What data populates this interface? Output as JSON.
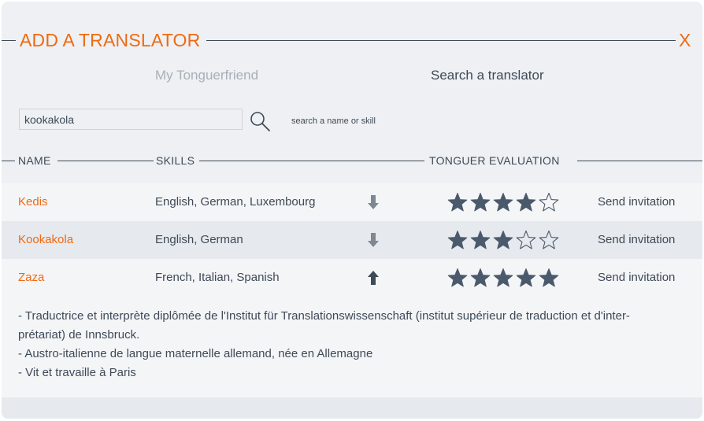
{
  "dialog": {
    "title": "ADD A TRANSLATOR",
    "close_label": "X"
  },
  "tabs": [
    {
      "label": "My Tonguerfriend",
      "active": false
    },
    {
      "label": "Search a translator",
      "active": true
    }
  ],
  "search": {
    "value": "kookakola",
    "hint": "search a name or skill",
    "icon": "search-icon"
  },
  "columns": {
    "name": "NAME",
    "skills": "SKILLS",
    "evaluation": "TONGUER EVALUATION"
  },
  "rows": [
    {
      "name": "Kedis",
      "skills": "English, German, Luxembourg",
      "arrow": "down",
      "rating": 4,
      "max_rating": 5,
      "action": "Send invitation"
    },
    {
      "name": "Kookakola",
      "skills": "English, German",
      "arrow": "down",
      "rating": 3,
      "max_rating": 5,
      "action": "Send invitation"
    },
    {
      "name": "Zaza",
      "skills": "French, Italian, Spanish",
      "arrow": "up",
      "rating": 5,
      "max_rating": 5,
      "action": "Send invitation"
    }
  ],
  "details": {
    "lines": [
      "- Traductrice et interprète diplômée de l'Institut für Translationswissenschaft (institut supérieur de traduction et d'inter-",
      "prétariat) de Innsbruck.",
      "- Austro-italienne de langue maternelle allemand, née en Allemagne",
      "- Vit et travaille à Paris"
    ]
  },
  "colors": {
    "accent": "#ef6a12",
    "text": "#3e4a57",
    "muted": "#a9b0b8",
    "background": "#eef0f3",
    "star": "#4a5a6c"
  }
}
